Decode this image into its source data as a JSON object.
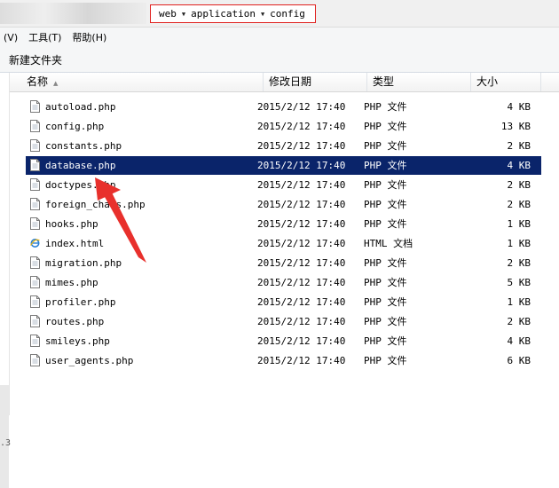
{
  "address": {
    "crumbs": [
      "web",
      "application",
      "config"
    ]
  },
  "menu": [
    "(V)",
    "工具(T)",
    "帮助(H)"
  ],
  "commands": {
    "new_folder": "新建文件夹"
  },
  "columns": {
    "name": "名称",
    "date": "修改日期",
    "type": "类型",
    "size": "大小"
  },
  "files": [
    {
      "name": "autoload.php",
      "date": "2015/2/12 17:40",
      "type": "PHP 文件",
      "size": "4 KB",
      "icon": "php-file-icon"
    },
    {
      "name": "config.php",
      "date": "2015/2/12 17:40",
      "type": "PHP 文件",
      "size": "13 KB",
      "icon": "php-file-icon"
    },
    {
      "name": "constants.php",
      "date": "2015/2/12 17:40",
      "type": "PHP 文件",
      "size": "2 KB",
      "icon": "php-file-icon"
    },
    {
      "name": "database.php",
      "date": "2015/2/12 17:40",
      "type": "PHP 文件",
      "size": "4 KB",
      "icon": "php-file-icon",
      "selected": true
    },
    {
      "name": "doctypes.php",
      "date": "2015/2/12 17:40",
      "type": "PHP 文件",
      "size": "2 KB",
      "icon": "php-file-icon"
    },
    {
      "name": "foreign_chars.php",
      "date": "2015/2/12 17:40",
      "type": "PHP 文件",
      "size": "2 KB",
      "icon": "php-file-icon"
    },
    {
      "name": "hooks.php",
      "date": "2015/2/12 17:40",
      "type": "PHP 文件",
      "size": "1 KB",
      "icon": "php-file-icon"
    },
    {
      "name": "index.html",
      "date": "2015/2/12 17:40",
      "type": "HTML 文档",
      "size": "1 KB",
      "icon": "ie-html-icon"
    },
    {
      "name": "migration.php",
      "date": "2015/2/12 17:40",
      "type": "PHP 文件",
      "size": "2 KB",
      "icon": "php-file-icon"
    },
    {
      "name": "mimes.php",
      "date": "2015/2/12 17:40",
      "type": "PHP 文件",
      "size": "5 KB",
      "icon": "php-file-icon"
    },
    {
      "name": "profiler.php",
      "date": "2015/2/12 17:40",
      "type": "PHP 文件",
      "size": "1 KB",
      "icon": "php-file-icon"
    },
    {
      "name": "routes.php",
      "date": "2015/2/12 17:40",
      "type": "PHP 文件",
      "size": "2 KB",
      "icon": "php-file-icon"
    },
    {
      "name": "smileys.php",
      "date": "2015/2/12 17:40",
      "type": "PHP 文件",
      "size": "4 KB",
      "icon": "php-file-icon"
    },
    {
      "name": "user_agents.php",
      "date": "2015/2/12 17:40",
      "type": "PHP 文件",
      "size": "6 KB",
      "icon": "php-file-icon"
    }
  ],
  "nav_fragment": ".3",
  "colors": {
    "selection": "#0a246a",
    "highlight_border": "#e0201e",
    "annotation_arrow": "#e8302c"
  }
}
